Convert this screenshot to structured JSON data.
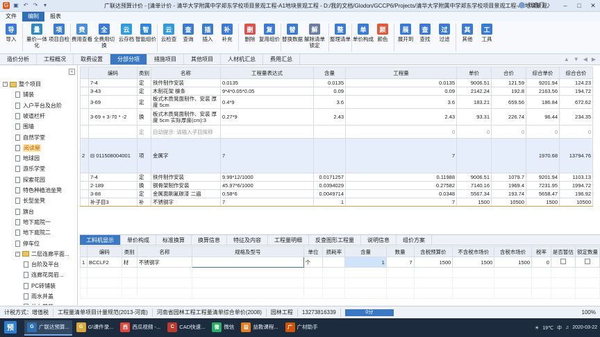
{
  "window": {
    "title": "广联达预算计价 - [清单计价 - 清华大学附属中学郑东学校项目景观工程-A1地块景观工程 - D:/我的文档/Glodon/GCCP6/Projects/清华大学附属中学郑东学校项目景观工程-A1地块景观工程.GB...",
    "user": "刘鑫门",
    "quick_access": [
      "app-logo-icon",
      "save-icon",
      "undo-icon",
      "redo-icon",
      "dropdown-icon"
    ]
  },
  "menu": [
    "文件",
    "编制",
    "报表"
  ],
  "ribbon": [
    {
      "label": "导入",
      "icon": "import-icon",
      "color": "#3a7bd5"
    },
    {
      "label": "量价一体化",
      "icon": "integrate-icon",
      "color": "#2e8bc0"
    },
    {
      "label": "项目自检",
      "icon": "check-icon",
      "color": "#3a7bd5"
    },
    {
      "label": "费用查看",
      "icon": "fee-view-icon",
      "color": "#4a90d9"
    },
    {
      "label": "全费用切换",
      "icon": "switch-icon",
      "color": "#3a7bd5"
    },
    {
      "label": "云存档",
      "icon": "cloud-save-icon",
      "color": "#2f9be0"
    },
    {
      "label": "智能组价",
      "icon": "smart-price-icon",
      "color": "#2e86de"
    },
    {
      "label": "云检查",
      "icon": "cloud-check-icon",
      "color": "#2f9be0"
    },
    {
      "label": "查询",
      "icon": "query-icon",
      "color": "#3a7bd5"
    },
    {
      "label": "插入",
      "icon": "insert-icon",
      "color": "#3a7bd5"
    },
    {
      "label": "补充",
      "icon": "supplement-icon",
      "color": "#3a7bd5"
    },
    {
      "label": "删除",
      "icon": "delete-icon",
      "color": "#d9534f"
    },
    {
      "label": "复用组价",
      "icon": "reuse-icon",
      "color": "#3a7bd5"
    },
    {
      "label": "替换数据",
      "icon": "replace-icon",
      "color": "#3a7bd5"
    },
    {
      "label": "解除清单锁定",
      "icon": "unlock-icon",
      "color": "#6a7fa8"
    },
    {
      "label": "整理清单",
      "icon": "organize-icon",
      "color": "#3a7bd5"
    },
    {
      "label": "单价构成",
      "icon": "unit-price-icon",
      "color": "#3a7bd5"
    },
    {
      "label": "颜色",
      "icon": "color-icon",
      "color": "#e05a3a"
    },
    {
      "label": "展开到",
      "icon": "expand-icon",
      "color": "#3a7bd5"
    },
    {
      "label": "查找",
      "icon": "find-icon",
      "color": "#3a7bd5"
    },
    {
      "label": "过滤",
      "icon": "filter-icon",
      "color": "#3a7bd5"
    },
    {
      "label": "其他",
      "icon": "other-icon",
      "color": "#3a7bd5"
    },
    {
      "label": "工具",
      "icon": "tools-icon",
      "color": "#3a7bd5"
    }
  ],
  "tabs": [
    "造价分析",
    "工程概况",
    "取费设置",
    "分部分项",
    "措施项目",
    "其他项目",
    "人材机汇总",
    "费用汇总"
  ],
  "active_tab": "分部分项",
  "tree": [
    {
      "label": "整个项目",
      "level": 0,
      "type": "root"
    },
    {
      "label": "铺装",
      "level": 1
    },
    {
      "label": "入户平台及台阶",
      "level": 1
    },
    {
      "label": "坡道栏杆",
      "level": 1
    },
    {
      "label": "围墙",
      "level": 1
    },
    {
      "label": "自然学堂",
      "level": 1
    },
    {
      "label": "阅读屋",
      "level": 1,
      "selected": true
    },
    {
      "label": "地球园",
      "level": 1
    },
    {
      "label": "游乐学堂",
      "level": 1
    },
    {
      "label": "探索花园",
      "level": 1
    },
    {
      "label": "特色种植池坐凳",
      "level": 1
    },
    {
      "label": "长型坐凳",
      "level": 1
    },
    {
      "label": "旗台",
      "level": 1
    },
    {
      "label": "地下庭院一",
      "level": 1
    },
    {
      "label": "地下庭院二",
      "level": 1
    },
    {
      "label": "停车位",
      "level": 1
    },
    {
      "label": "二层连廊平面...",
      "level": 1,
      "type": "folder"
    },
    {
      "label": "台阶及平台",
      "level": 2
    },
    {
      "label": "连廊花岗岩...",
      "level": 2
    },
    {
      "label": "PC砖铺装",
      "level": 2
    },
    {
      "label": "雨水井盖",
      "level": 2
    },
    {
      "label": "什么花草",
      "level": 2
    }
  ],
  "grid": {
    "headers": [
      "",
      "编码",
      "类别",
      "名称",
      "工程量表达式",
      "含量",
      "工程量",
      "单价",
      "合价",
      "综合单价",
      "综合合价"
    ],
    "rows": [
      {
        "no": "",
        "code": "7-4",
        "type": "定",
        "name": "铁件制作安装",
        "expr": "0.0135",
        "content": "0.0135",
        "qty": "0.0135",
        "price": "9006.51",
        "total": "121.59",
        "cprice": "9201.94",
        "ctotal": "124.23"
      },
      {
        "no": "",
        "code": "3-43",
        "type": "定",
        "name": "木制花架 檩条",
        "expr": "9*4*0.05*0.05",
        "content": "0.09",
        "qty": "0.09",
        "price": "2142.24",
        "total": "192.8",
        "cprice": "2163.56",
        "ctotal": "194.72"
      },
      {
        "no": "",
        "code": "3-69",
        "type": "定",
        "name": "板式木质凳面制作、安装 厚度 5cm",
        "expr": "0.4*9",
        "content": "3.6",
        "qty": "3.6",
        "price": "183.21",
        "total": "659.56",
        "cprice": "186.84",
        "ctotal": "672.62"
      },
      {
        "no": "",
        "code": "3-69 + 3-70 * -2",
        "type": "换",
        "name": "板式木质凳面制作、安装 厚度 5cm 实际厚度(cm):3",
        "expr": "0.27*9",
        "content": "2.43",
        "qty": "2.43",
        "price": "93.31",
        "total": "226.74",
        "cprice": "96.44",
        "ctotal": "234.35"
      },
      {
        "no": "",
        "code": "",
        "type": "定",
        "name": "自动提示: 请输入子目简称",
        "expr": "",
        "content": "",
        "qty": "0",
        "price": "0",
        "total": "0",
        "cprice": "0",
        "ctotal": "0",
        "hint": true
      },
      {
        "no": "2",
        "code": "011508004001",
        "type": "项",
        "name": "金属字",
        "expr": "7",
        "content": "",
        "qty": "7",
        "price": "",
        "total": "",
        "cprice": "1970.68",
        "ctotal": "13794.76",
        "main": true
      },
      {
        "no": "",
        "code": "7-4",
        "type": "定",
        "name": "铁件制作安装",
        "expr": "9.99*12/1000",
        "content": "0.0171257",
        "qty": "0.11988",
        "price": "9006.51",
        "total": "1079.7",
        "cprice": "9201.94",
        "ctotal": "1103.13"
      },
      {
        "no": "",
        "code": "2-189",
        "type": "换",
        "name": "钢骨架制作安装",
        "expr": "45.97*6/1000",
        "content": "0.0394029",
        "qty": "0.27582",
        "price": "7140.16",
        "total": "1969.4",
        "cprice": "7231.95",
        "ctotal": "1994.72"
      },
      {
        "no": "",
        "code": "3-88",
        "type": "定",
        "name": "金属面刷氟碳漆 二遍",
        "expr": "0.58*6",
        "content": "0.0049714",
        "qty": "0.0348",
        "price": "5567.34",
        "total": "193.74",
        "cprice": "5658.47",
        "ctotal": "196.92"
      },
      {
        "no": "",
        "code": "补子目3",
        "type": "补",
        "name": "不锈钢字",
        "expr": "7",
        "content": "1",
        "qty": "7",
        "price": "1500",
        "total": "10500",
        "cprice": "1500",
        "ctotal": "10500"
      }
    ]
  },
  "bottom_tabs": [
    "工料机显示",
    "单价构成",
    "标准换算",
    "换算信息",
    "特征及内容",
    "工程量明细",
    "反查图形工程量",
    "说明信息",
    "组价方案"
  ],
  "lower_grid": {
    "headers": [
      "",
      "编码",
      "类别",
      "名称",
      "规格及型号",
      "单位",
      "损耗率",
      "含量",
      "数量",
      "含税预算价",
      "不含税市场价",
      "含税市场价",
      "税率",
      "是否暂估",
      "锁定数量"
    ],
    "rows": [
      {
        "no": "1",
        "code": "BCCLF2",
        "type": "材",
        "name": "不锈钢字",
        "spec": "",
        "unit": "个",
        "loss": "",
        "content": "1",
        "qty": "7",
        "tax_budget": "1500",
        "notax_market": "1500",
        "tax_market": "1500",
        "rate": "0"
      }
    ]
  },
  "status": {
    "mode": "计税方式：增值税",
    "standard": "工程量清单项目计量规范(2013-河南)",
    "quota": "河南省园林工程工程量清单综合单价(2008)",
    "discipline": "园林工程",
    "phone": "13273816339",
    "progress": "0分",
    "zoom": "100%"
  },
  "taskbar": [
    {
      "label": "",
      "icon": "start-icon",
      "color": "#2d7dd2",
      "text": "预"
    },
    {
      "label": "广联达预算...",
      "icon": "glodon-icon",
      "color": "#2c6fb5",
      "text": "G",
      "active": true
    },
    {
      "label": "G\\课件录...",
      "icon": "folder-icon",
      "color": "#d9a93a",
      "text": "G"
    },
    {
      "label": "西瓜视频 -...",
      "icon": "video-icon",
      "color": "#e2463b",
      "text": "西"
    },
    {
      "label": "CAD快速...",
      "icon": "cad-icon",
      "color": "#c0392b",
      "text": "C"
    },
    {
      "label": "微信",
      "icon": "wechat-icon",
      "color": "#2aae67",
      "text": "微"
    },
    {
      "label": "益教课程...",
      "icon": "course-icon",
      "color": "#e67e22",
      "text": "益"
    },
    {
      "label": "广材助手",
      "icon": "material-icon",
      "color": "#d35400",
      "text": "广"
    }
  ],
  "tray": {
    "temp": "19℃",
    "lang": "中",
    "date": "2020-03-22"
  }
}
